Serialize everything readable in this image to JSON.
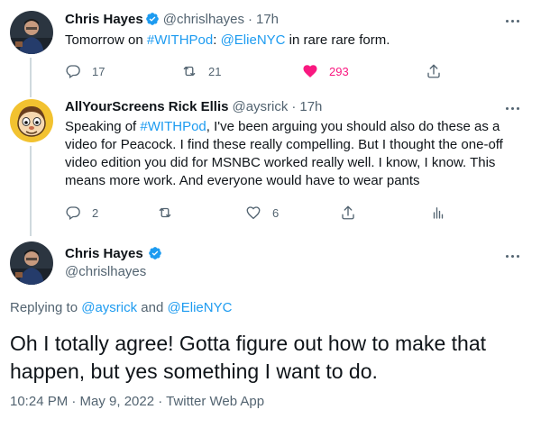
{
  "tweet1": {
    "author_name": "Chris Hayes",
    "author_handle": "@chrislhayes",
    "time": "17h",
    "text_pre": "Tomorrow on ",
    "hashtag": "#WITHPod",
    "text_mid": ": ",
    "mention": "@ElieNYC",
    "text_post": " in rare rare form.",
    "reply_count": "17",
    "retweet_count": "21",
    "like_count": "293",
    "liked": true
  },
  "tweet2": {
    "author_name": "AllYourScreens Rick Ellis",
    "author_handle": "@aysrick",
    "time": "17h",
    "text_pre": "Speaking of ",
    "hashtag": "#WITHPod",
    "text_post": ", I've been arguing you should also do these as a video for Peacock. I find these really compelling. But I thought the one-off video edition you did for MSNBC worked really well. I know, I know. This means more work. And everyone would have to wear pants",
    "reply_count": "2",
    "retweet_count": "",
    "like_count": "6"
  },
  "main": {
    "author_name": "Chris Hayes",
    "author_handle": "@chrislhayes",
    "replying_prefix": "Replying to ",
    "replying_to_1": "@aysrick",
    "replying_and": " and ",
    "replying_to_2": "@ElieNYC",
    "text": "Oh I totally agree! Gotta figure out how to make that happen, but yes something I want to do.",
    "timestamp": "10:24 PM · May 9, 2022 · Twitter Web App"
  },
  "colors": {
    "accent": "#1d9bf0",
    "like": "#f91880",
    "muted": "#536471"
  },
  "icons": [
    "verified-badge-icon",
    "more-dots-icon",
    "reply-icon",
    "retweet-icon",
    "like-icon",
    "share-icon",
    "analytics-icon"
  ]
}
